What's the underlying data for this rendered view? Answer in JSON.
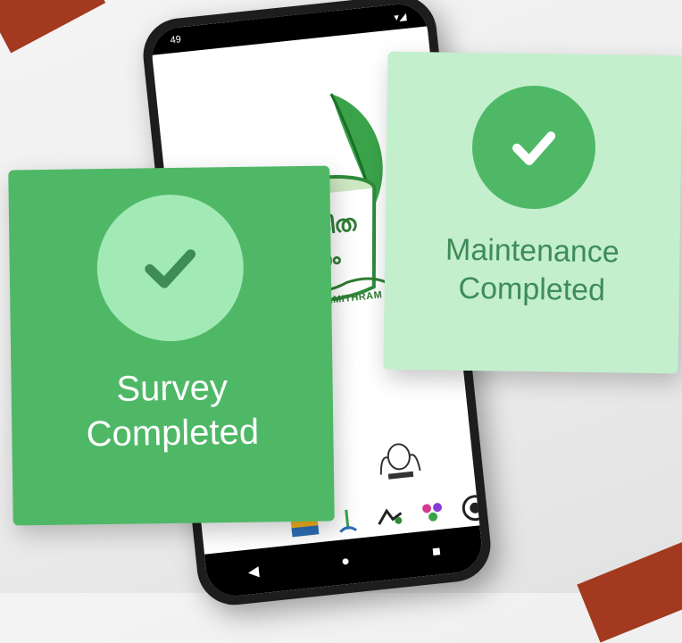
{
  "phone": {
    "status_time": "49",
    "logo_malayalam_line1": "ഹരിത",
    "logo_malayalam_line2": "മിത്രം",
    "logo_caption": "HARITHAMITHRAM",
    "nav": {
      "back": "◀",
      "home": "●",
      "recents": "■"
    }
  },
  "survey_card": {
    "line1": "Survey",
    "line2": "Completed"
  },
  "maintenance_card": {
    "line1": "Maintenance",
    "line2": "Completed"
  },
  "colors": {
    "survey_card_bg": "#4fb867",
    "maintenance_card_bg": "#c3efcd",
    "accent_dark_green": "#3e8c57",
    "brand_red": "#a33a1f"
  }
}
